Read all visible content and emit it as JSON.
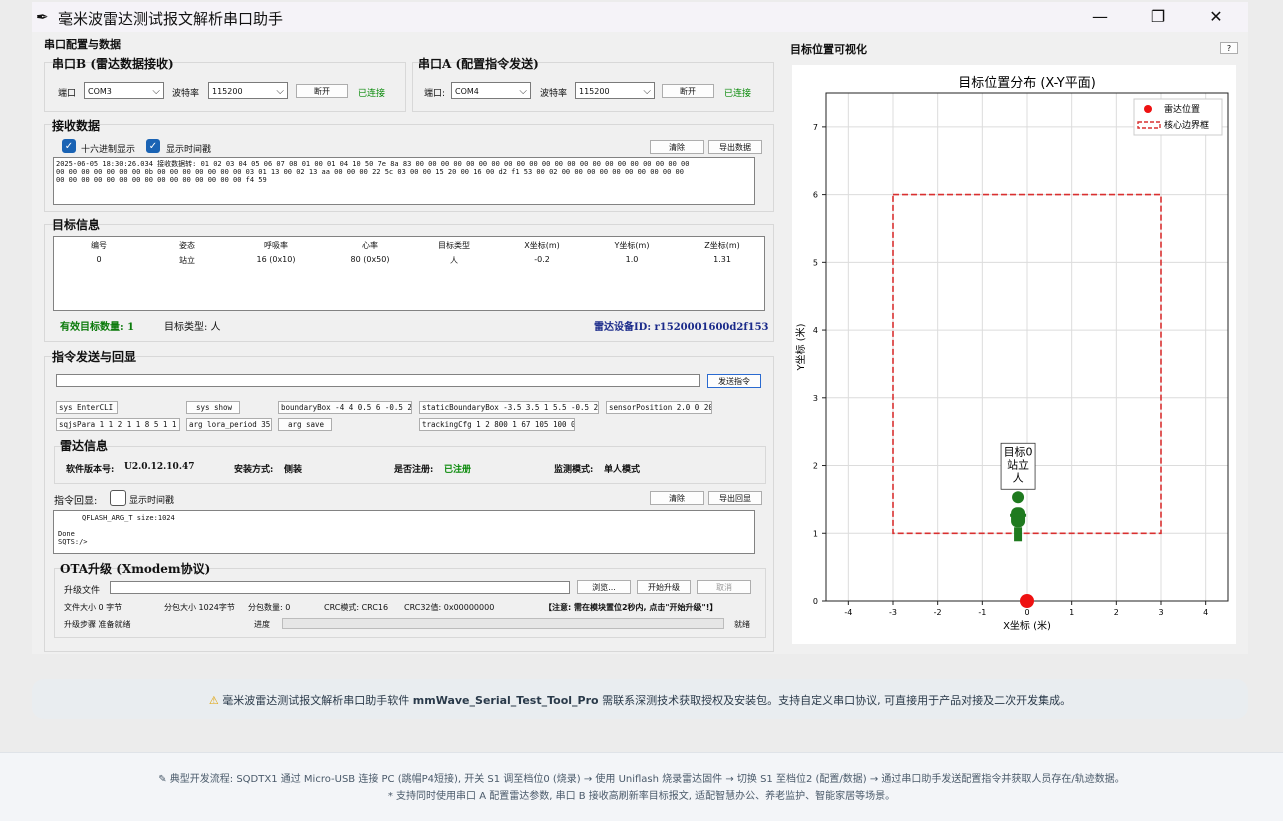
{
  "window": {
    "title": "毫米波雷达测试报文解析串口助手",
    "minimize": "—",
    "maximize": "❐",
    "close": "✕"
  },
  "serial": {
    "section_title": "串口配置与数据",
    "b": {
      "title": "串口B (雷达数据接收)",
      "port_label": "端口",
      "port": "COM3",
      "baud_label": "波特率",
      "baud": "115200",
      "button": "断开",
      "status": "已连接"
    },
    "a": {
      "title": "串口A (配置指令发送)",
      "port_label": "端口:",
      "port": "COM4",
      "baud_label": "波特率",
      "baud": "115200",
      "button": "断开",
      "status": "已连接"
    }
  },
  "receive": {
    "title": "接收数据",
    "hex_label": "十六进制显示",
    "time_label": "显示时间戳",
    "clear": "清除",
    "export": "导出数据",
    "lines": [
      "2025-06-05 18:30:26.034 接收数据转: 01 02 03 04 05 06 07 08 01 00 01 04 10 50 7e 8a 83 00 00 00 00 00 00 00 00 00 00 00 00 00 00 00 00 00 00 00 00 00 00",
      "00 00 00 00 00 00 00 0b 00 00 00 00 00 00 00 03 01 13 00 02 13 aa 00 00 00 22 5c 03 00 00 15 20 00 16 00 d2 f1 53 00 02 00 00 00 00 00 00 00 00 00 00",
      "00 00 00 00 00 00 00 00 00 00 00 00 00 00 00 f4 59"
    ]
  },
  "target": {
    "title": "目标信息",
    "columns": [
      "编号",
      "姿态",
      "呼吸率",
      "心率",
      "目标类型",
      "X坐标(m)",
      "Y坐标(m)",
      "Z坐标(m)"
    ],
    "row": [
      "0",
      "站立",
      "16 (0x10)",
      "80 (0x50)",
      "人",
      "-0.2",
      "1.0",
      "1.31"
    ],
    "count": "有效目标数量: 1",
    "type": "目标类型: 人",
    "device": "雷达设备ID: r1520001600d2f153"
  },
  "command": {
    "title": "指令发送与回显",
    "send": "发送指令",
    "cmds": [
      "sys EnterCLI",
      "sys show",
      "boundaryBox -4 4 0.5 6 -0.5 2",
      "staticBoundaryBox -3.5 3.5 1 5.5 -0.5 2",
      "sensorPosition 2.0 0 20",
      "sqjsPara 1 1 2 1 1 8 5 1 1",
      "arg lora_period 35",
      "arg save",
      "trackingCfg 1 2 800 1 67 105 100 0"
    ]
  },
  "radar": {
    "title": "雷达信息",
    "fw_label": "软件版本号:",
    "fw": "U2.0.12.10.47",
    "mount_label": "安装方式:",
    "mount": "侧装",
    "reg_label": "是否注册:",
    "reg": "已注册",
    "mode_label": "监测模式:",
    "mode": "单人模式"
  },
  "echo": {
    "label": "指令回显:",
    "time_label": "显示时间戳",
    "clear": "清除",
    "export": "导出回显",
    "lines": [
      "QFLASH_ARG_T size:1024",
      "",
      "Done",
      "SQTS:/>"
    ]
  },
  "ota": {
    "title": "OTA升级 (Xmodem协议)",
    "file_label": "升级文件",
    "browse": "浏览...",
    "start": "开始升级",
    "cancel": "取消",
    "size": "文件大小  0 字节",
    "pkt": "分包大小  1024字节",
    "pkt_count": "分包数量: 0",
    "crc": "CRC模式: CRC16",
    "crc32": "CRC32值: 0x00000000",
    "note": "【注意: 需在模块置位2秒内, 点击\"开始升级\"!】",
    "step": "升级步骤   准备就绪",
    "progress": "进度",
    "ready": "就绪"
  },
  "viz": {
    "title": "目标位置可视化",
    "help": "?"
  },
  "chart_data": {
    "type": "scatter",
    "title": "目标位置分布 (X-Y平面)",
    "xlabel": "X坐标 (米)",
    "ylabel": "Y坐标 (米)",
    "xlim": [
      -4.5,
      4.5
    ],
    "ylim": [
      0,
      7.5
    ],
    "xticks": [
      -4,
      -3,
      -2,
      -1,
      0,
      1,
      2,
      3,
      4
    ],
    "yticks": [
      0,
      1,
      2,
      3,
      4,
      5,
      6,
      7
    ],
    "grid": true,
    "legend": "top-right",
    "legend_entries": [
      "雷达位置",
      "核心边界框"
    ],
    "radar": {
      "x": 0,
      "y": 0,
      "color": "#ee1111"
    },
    "boundary": {
      "x": [
        -3,
        3
      ],
      "y": [
        1,
        6
      ],
      "color": "#d93030"
    },
    "target": {
      "x": -0.2,
      "y": 1.0,
      "label": [
        "目标0",
        "站立",
        "人"
      ],
      "color": "#1f7a1f"
    }
  },
  "notice": {
    "icon": "⚠",
    "pre": "毫米波雷达测试报文解析串口助手软件",
    "bold": "mmWave_Serial_Test_Tool_Pro",
    "post": "需联系深测技术获取授权及安装包。支持自定义串口协议, 可直接用于产品对接及二次开发集成。"
  },
  "footer": {
    "icon": "✎",
    "line1": "典型开发流程: SQDTX1 通过 Micro-USB 连接 PC (跳帽P4短接), 开关 S1 调至档位0 (烧录) → 使用 Uniflash 烧录雷达固件 → 切换 S1 至档位2 (配置/数据) → 通过串口助手发送配置指令并获取人员存在/轨迹数据。",
    "line2": "* 支持同时使用串口 A 配置雷达参数, 串口 B 接收高刷新率目标报文, 适配智慧办公、养老监护、智能家居等场景。"
  }
}
